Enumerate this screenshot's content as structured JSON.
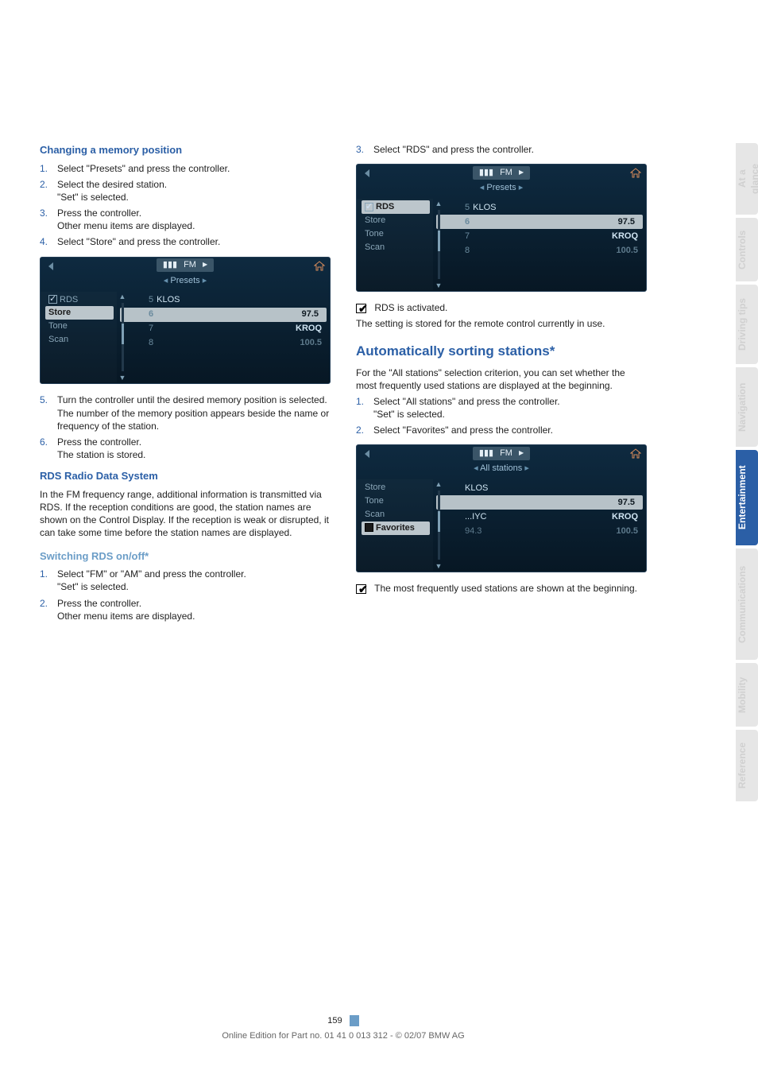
{
  "sections": {
    "changing_memory": {
      "heading": "Changing a memory position",
      "steps": [
        "Select \"Presets\" and press the controller.",
        "Select the desired station.\n\"Set\" is selected.",
        "Press the controller.\nOther menu items are displayed.",
        "Select \"Store\" and press the controller."
      ],
      "after_steps": [
        "Turn the controller until the desired memory position is selected.\nThe number of the memory position appears beside the name or frequency of the station.",
        "Press the controller.\nThe station is stored."
      ],
      "after_start_num": 5
    },
    "rds_system": {
      "heading": "RDS Radio Data System",
      "body": "In the FM frequency range, additional information is transmitted via RDS. If the reception conditions are good, the station names are shown on the Control Display. If the reception is weak or disrupted, it can take some time before the station names are displayed."
    },
    "switching_rds": {
      "heading": "Switching RDS on/off*",
      "steps": [
        "Select \"FM\" or \"AM\" and press the controller.\n\"Set\" is selected.",
        "Press the controller.\nOther menu items are displayed.",
        "Select \"RDS\" and press the controller."
      ],
      "note_line1": "RDS is activated.",
      "note_line2": "The setting is stored for the remote control currently in use."
    },
    "auto_sort": {
      "heading": "Automatically sorting stations*",
      "body": "For the \"All stations\" selection criterion, you can set whether the most frequently used stations are displayed at the beginning.",
      "steps": [
        "Select \"All stations\" and press the controller.\n\"Set\" is selected.",
        "Select \"Favorites\" and press the controller."
      ],
      "note": "The most frequently used stations are shown at the beginning."
    }
  },
  "displays": {
    "presets": {
      "band": "FM",
      "submenu": "Presets",
      "left_items": [
        "RDS",
        "Store",
        "Tone",
        "Scan"
      ],
      "left_selected": "Store",
      "left_checkbox_on": "RDS",
      "rows": [
        {
          "num": "5",
          "left": "KLOS",
          "right": ""
        },
        {
          "num": "6",
          "left": "",
          "right": "97.5"
        },
        {
          "num": "7",
          "left": "",
          "right": "KROQ"
        },
        {
          "num": "8",
          "left": "",
          "right": "100.5"
        }
      ],
      "hl_index": 1
    },
    "rds": {
      "band": "FM",
      "submenu": "Presets",
      "left_items": [
        "RDS",
        "Store",
        "Tone",
        "Scan"
      ],
      "left_selected": "RDS",
      "left_checkbox_on": "RDS",
      "rows": [
        {
          "num": "5",
          "left": "KLOS",
          "right": ""
        },
        {
          "num": "6",
          "left": "",
          "right": "97.5"
        },
        {
          "num": "7",
          "left": "",
          "right": "KROQ"
        },
        {
          "num": "8",
          "left": "",
          "right": "100.5"
        }
      ],
      "hl_index": 1
    },
    "allstations": {
      "band": "FM",
      "submenu": "All stations",
      "left_items": [
        "Store",
        "Tone",
        "Scan",
        "Favorites"
      ],
      "left_selected": "Favorites",
      "left_checkbox_fill": "Favorites",
      "rows": [
        {
          "num": "",
          "left": "KLOS",
          "right": ""
        },
        {
          "num": "",
          "left": "",
          "right": "97.5"
        },
        {
          "num": "",
          "left": "...IYC",
          "right": "KROQ"
        },
        {
          "num": "",
          "left": "94.3",
          "right": "100.5"
        }
      ],
      "hl_index": 1
    }
  },
  "side_tabs": [
    {
      "label": "At a glance",
      "active": false
    },
    {
      "label": "Controls",
      "active": false
    },
    {
      "label": "Driving tips",
      "active": false
    },
    {
      "label": "Navigation",
      "active": false
    },
    {
      "label": "Entertainment",
      "active": true
    },
    {
      "label": "Communications",
      "active": false
    },
    {
      "label": "Mobility",
      "active": false
    },
    {
      "label": "Reference",
      "active": false
    }
  ],
  "footer": {
    "page": "159",
    "edition": "Online Edition for Part no. 01 41 0 013 312 - © 02/07 BMW AG"
  }
}
